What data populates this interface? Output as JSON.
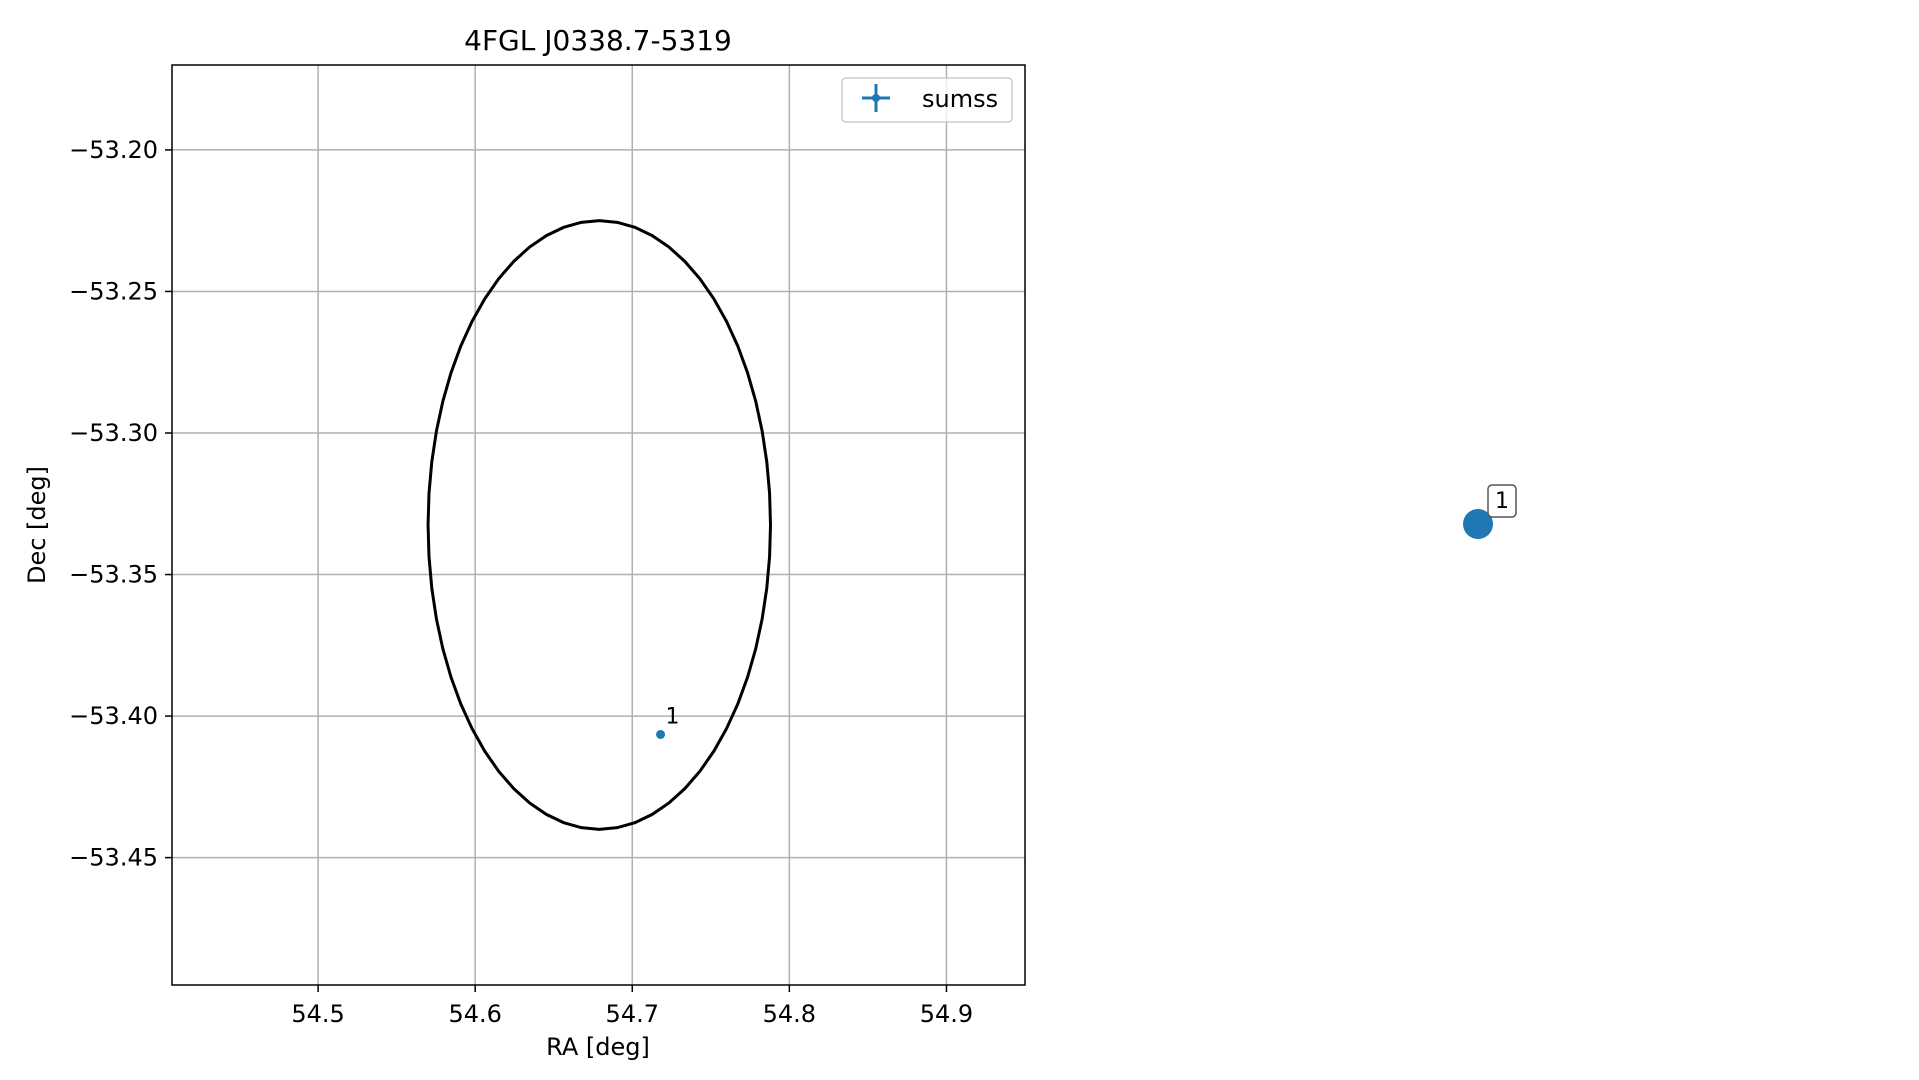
{
  "chart_data": [
    {
      "type": "scatter",
      "title": "4FGL J0338.7-5319",
      "xlabel": "RA [deg]",
      "ylabel": "Dec [deg]",
      "xlim": [
        54.407,
        54.95
      ],
      "ylim": [
        -53.495,
        -53.17
      ],
      "x_ticks": [
        54.5,
        54.6,
        54.7,
        54.8,
        54.9
      ],
      "x_tick_labels": [
        "54.5",
        "54.6",
        "54.7",
        "54.8",
        "54.9"
      ],
      "y_ticks": [
        -53.2,
        -53.25,
        -53.3,
        -53.35,
        -53.4,
        -53.45
      ],
      "y_tick_labels": [
        "−53.20",
        "−53.25",
        "−53.30",
        "−53.35",
        "−53.40",
        "−53.45"
      ],
      "grid": true,
      "legend": {
        "placement": "top-right",
        "entries": [
          {
            "label": "sumss",
            "marker": "errorbar-plus",
            "color": "#1f77b4"
          }
        ]
      },
      "series": [
        {
          "name": "sumss",
          "color": "#1f77b4",
          "points": [
            {
              "label": "1",
              "x": 54.718,
              "y": -53.4065
            }
          ]
        }
      ],
      "ellipse": {
        "center_x": 54.679,
        "center_y": -53.3325,
        "semi_ra": 0.109,
        "semi_dec": 0.1075,
        "color": "#000000"
      }
    },
    {
      "type": "scatter",
      "axes_visible": false,
      "series": [
        {
          "color": "#1f77b4",
          "points": [
            {
              "label": "1",
              "x": 0,
              "y": 0
            }
          ]
        }
      ]
    }
  ]
}
